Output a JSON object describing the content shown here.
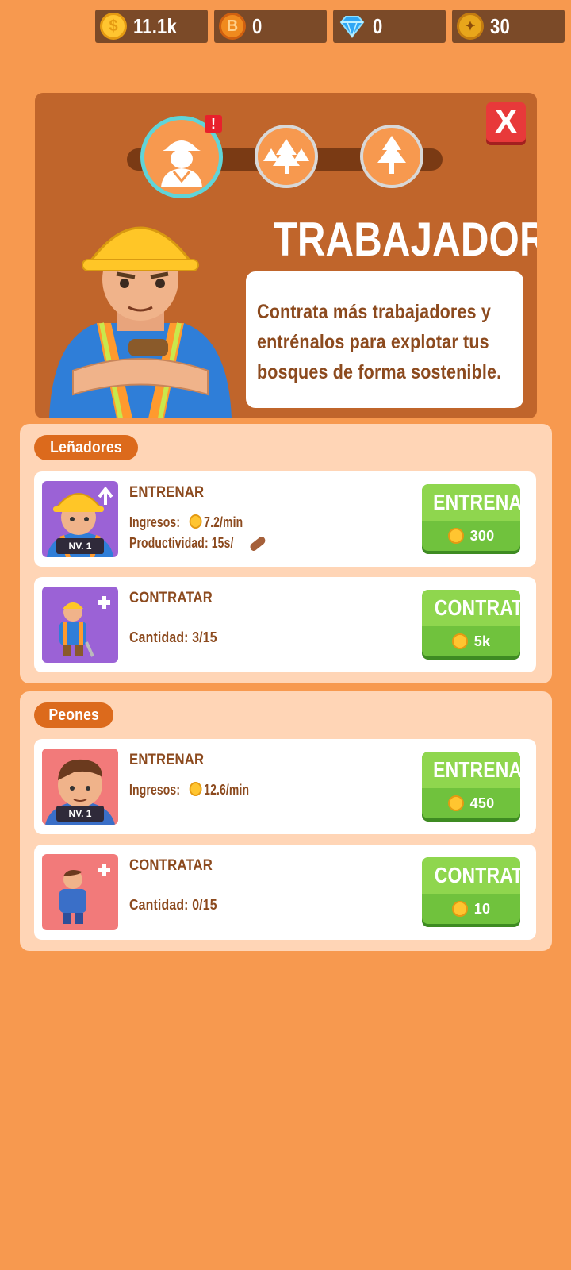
{
  "currency": [
    {
      "icon": "gold-coin-icon",
      "value": "11.1k"
    },
    {
      "icon": "bronze-coin-icon",
      "value": "0"
    },
    {
      "icon": "diamond-icon",
      "value": "0"
    },
    {
      "icon": "medal-icon",
      "value": "30"
    }
  ],
  "header": {
    "title": "TRABAJADORES",
    "description": [
      "Contrata más trabajadores y",
      "entrénalos para explotar tus",
      "bosques de forma sostenible."
    ],
    "close_label": "X",
    "alert": "!"
  },
  "sections": [
    {
      "label": "Leñadores",
      "train": {
        "title": "ENTRENAR",
        "level": "NV. 1",
        "income_label": "Ingresos:",
        "income": "7.2/min",
        "productivity": "Productividad: 15s/",
        "button": "ENTRENAR",
        "cost": "300"
      },
      "hire": {
        "title": "CONTRATAR",
        "quantity": "Cantidad: 3/15",
        "button": "CONTRATAR",
        "cost": "5k"
      }
    },
    {
      "label": "Peones",
      "train": {
        "title": "ENTRENAR",
        "level": "NV. 1",
        "income_label": "Ingresos:",
        "income": "12.6/min",
        "button": "ENTRENAR",
        "cost": "450"
      },
      "hire": {
        "title": "CONTRATAR",
        "quantity": "Cantidad: 0/15",
        "button": "CONTRATAR",
        "cost": "10"
      }
    }
  ],
  "colors": {
    "background": "#f7994f",
    "panel": "#c0652b",
    "button_green": "#70c23d",
    "close_red": "#e8393a"
  }
}
